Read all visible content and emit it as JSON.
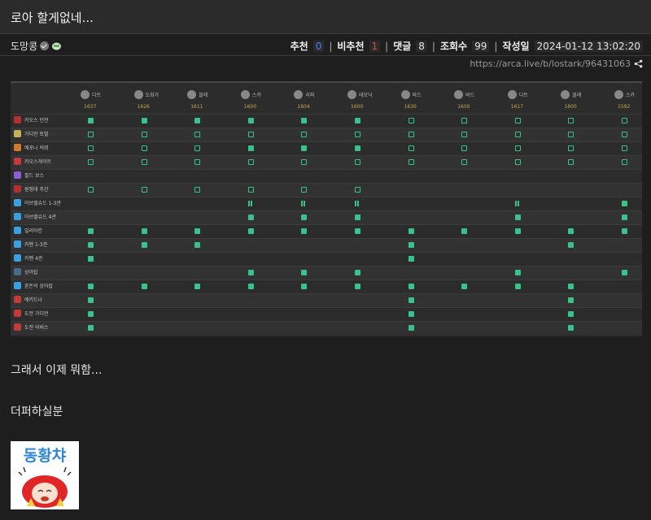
{
  "post": {
    "title": "로아 할게없네...",
    "author": "도망콩",
    "stats": {
      "upvote_label": "추천",
      "upvote_value": "0",
      "downvote_label": "비추천",
      "downvote_value": "1",
      "comments_label": "댓글",
      "comments_value": "8",
      "views_label": "조회수",
      "views_value": "99",
      "date_label": "작성일",
      "date_value": "2024-01-12 13:02:20"
    },
    "url": "https://arca.live/b/lostark/96431063",
    "body_lines": [
      "그래서 이제 뭐함...",
      "더퍼하실분"
    ],
    "sticker_text": "동황챠"
  },
  "table": {
    "characters": [
      "디트",
      "도화가",
      "블레",
      "스카",
      "리퍼",
      "데모닉",
      "바드",
      "바드",
      "디트",
      "블레",
      "스카"
    ],
    "item_levels": [
      "1637",
      "1626",
      "1611",
      "1600",
      "1604",
      "1600",
      "1630",
      "1600",
      "1617",
      "1600",
      "1592"
    ],
    "rows": [
      {
        "label": "카오스 던전",
        "icon_color": "#b33030",
        "cells": "CCCCCCBBBBB"
      },
      {
        "label": "가디언 토벌",
        "icon_color": "#c2b05a",
        "cells": "BBBBBBBBBBB"
      },
      {
        "label": "에포나 의뢰",
        "icon_color": "#d07c2a",
        "cells": "BBBCCCBBBBB"
      },
      {
        "label": "카오스게이트",
        "icon_color": "#c23a3a",
        "cells": "BBBBBBBBBBB"
      },
      {
        "label": "필드 보스",
        "icon_color": "#8a5fd6",
        "cells": "..........."
      },
      {
        "label": "원정대 주간",
        "icon_color": "#b33030",
        "cells": "BBBBBB....."
      },
      {
        "label": "아브렐슈드 1-3관",
        "icon_color": "#3aa0e0",
        "cells": "...PPP..P.C"
      },
      {
        "label": "아브렐슈드 4관",
        "icon_color": "#3aa0e0",
        "cells": "...CCC..C.C"
      },
      {
        "label": "일리아칸",
        "icon_color": "#3aa0e0",
        "cells": "CCCCCCCCCCC"
      },
      {
        "label": "카멘 1-3관",
        "icon_color": "#3aa0e0",
        "cells": "CCC...C..C."
      },
      {
        "label": "카멘 4관",
        "icon_color": "#3aa0e0",
        "cells": "C.....C...."
      },
      {
        "label": "상아탑",
        "icon_color": "#4a6b8a",
        "cells": "...CCC..C.C"
      },
      {
        "label": "혼돈의 상아탑",
        "icon_color": "#3aa0e0",
        "cells": "CCCCCCCCCC."
      },
      {
        "label": "에키드나",
        "icon_color": "#c23a3a",
        "cells": "C.....C..C."
      },
      {
        "label": "도전 가디언",
        "icon_color": "#c23a3a",
        "cells": "C.....C..C."
      },
      {
        "label": "도전 어비스",
        "icon_color": "#c23a3a",
        "cells": "C.....C..C."
      }
    ]
  },
  "colors": {
    "accent": "#39c28a",
    "upvote": "#4a7dff",
    "downvote": "#e64545"
  }
}
